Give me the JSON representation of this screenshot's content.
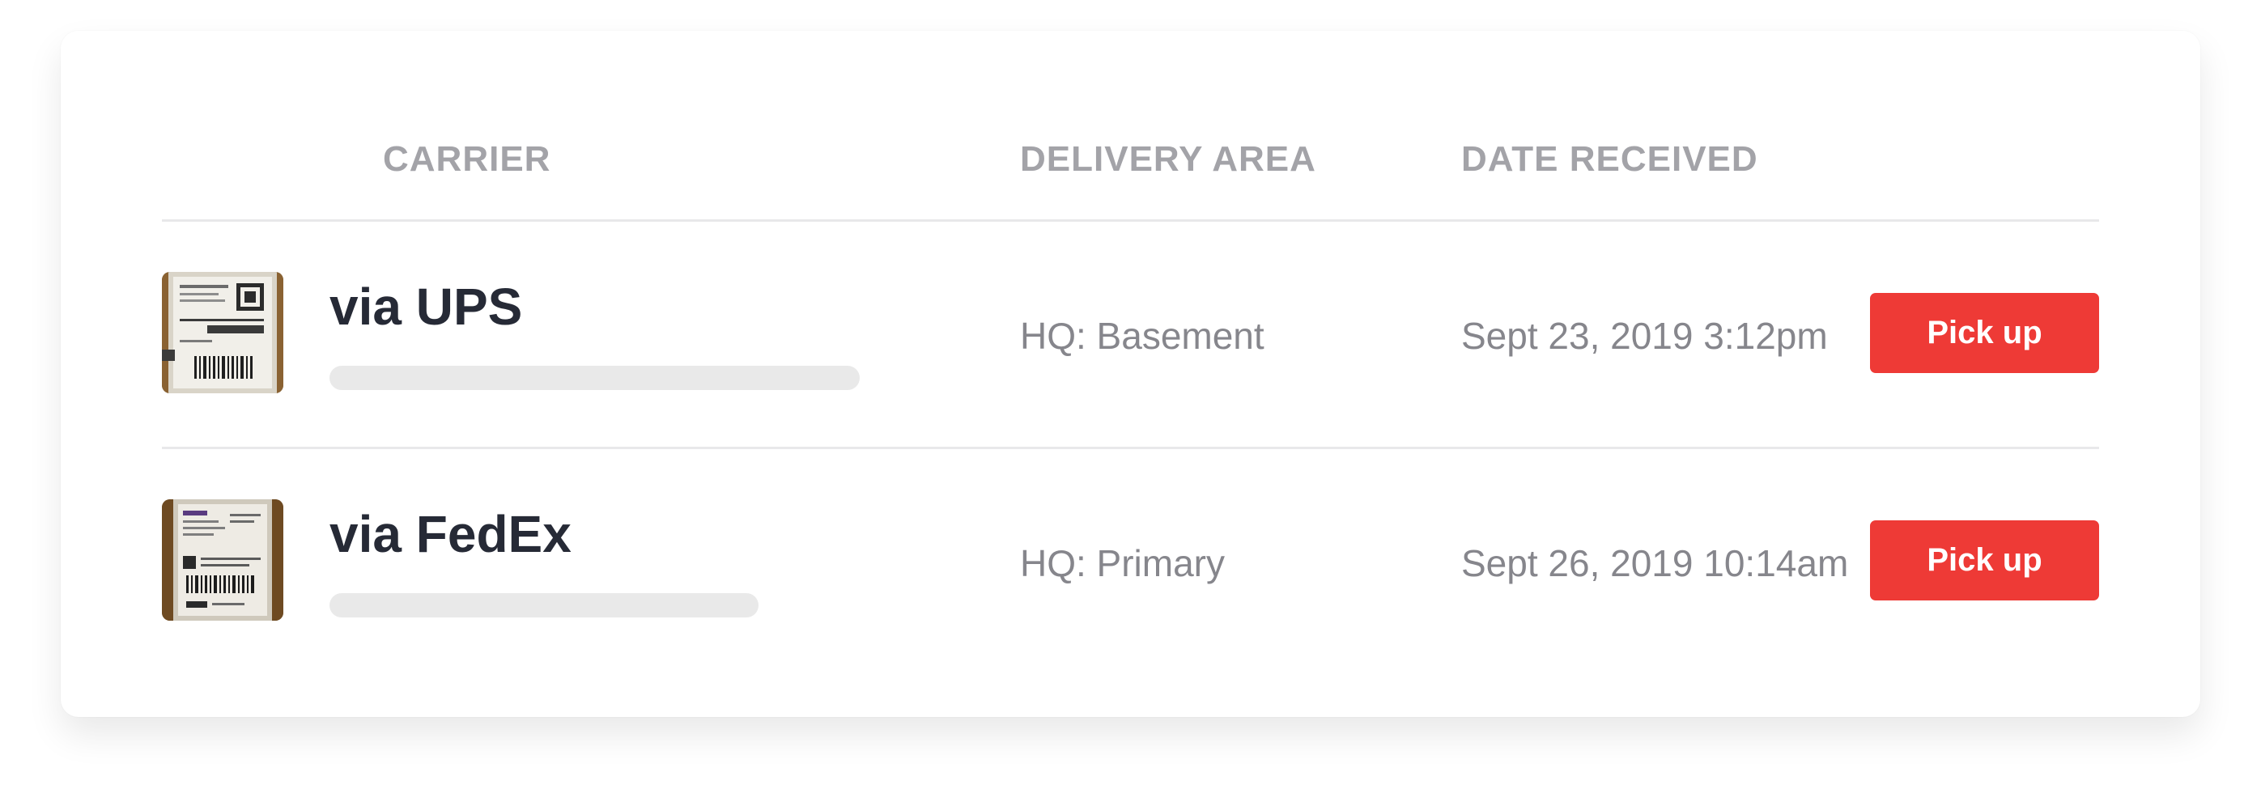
{
  "table": {
    "headers": {
      "carrier": "CARRIER",
      "delivery_area": "DELIVERY AREA",
      "date_received": "DATE RECEIVED"
    },
    "rows": [
      {
        "carrier": "via UPS",
        "delivery_area": "HQ: Basement",
        "date_received": "Sept 23, 2019 3:12pm",
        "action_label": "Pick up",
        "thumbnail": "package-label-photo"
      },
      {
        "carrier": "via FedEx",
        "delivery_area": "HQ: Primary",
        "date_received": "Sept 26, 2019 10:14am",
        "action_label": "Pick up",
        "thumbnail": "package-label-photo"
      }
    ]
  },
  "colors": {
    "accent": "#ee3a36",
    "heading_text": "#a3a3a8",
    "carrier_text": "#262a36",
    "body_text": "#86868c",
    "divider": "#e8e8ea",
    "placeholder_bar": "#e9e9e9"
  }
}
